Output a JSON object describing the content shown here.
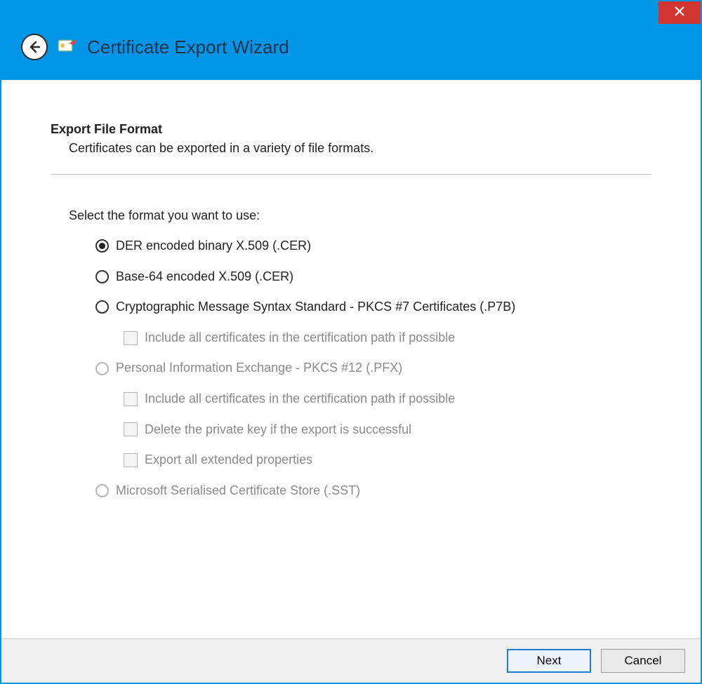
{
  "window": {
    "title": "Certificate Export Wizard"
  },
  "header": {
    "section_title": "Export File Format",
    "section_subtitle": "Certificates can be exported in a variety of file formats."
  },
  "prompt": "Select the format you want to use:",
  "options": {
    "opt1": {
      "label": "DER encoded binary X.509 (.CER)",
      "selected": true,
      "enabled": true
    },
    "opt2": {
      "label": "Base-64 encoded X.509 (.CER)",
      "selected": false,
      "enabled": true
    },
    "opt3": {
      "label": "Cryptographic Message Syntax Standard - PKCS #7 Certificates (.P7B)",
      "selected": false,
      "enabled": true
    },
    "opt3_chk1": {
      "label": "Include all certificates in the certification path if possible",
      "checked": false,
      "enabled": false
    },
    "opt4": {
      "label": "Personal Information Exchange - PKCS #12 (.PFX)",
      "selected": false,
      "enabled": false
    },
    "opt4_chk1": {
      "label": "Include all certificates in the certification path if possible",
      "checked": false,
      "enabled": false
    },
    "opt4_chk2": {
      "label": "Delete the private key if the export is successful",
      "checked": false,
      "enabled": false
    },
    "opt4_chk3": {
      "label": "Export all extended properties",
      "checked": false,
      "enabled": false
    },
    "opt5": {
      "label": "Microsoft Serialised Certificate Store (.SST)",
      "selected": false,
      "enabled": false
    }
  },
  "footer": {
    "next": "Next",
    "cancel": "Cancel"
  }
}
